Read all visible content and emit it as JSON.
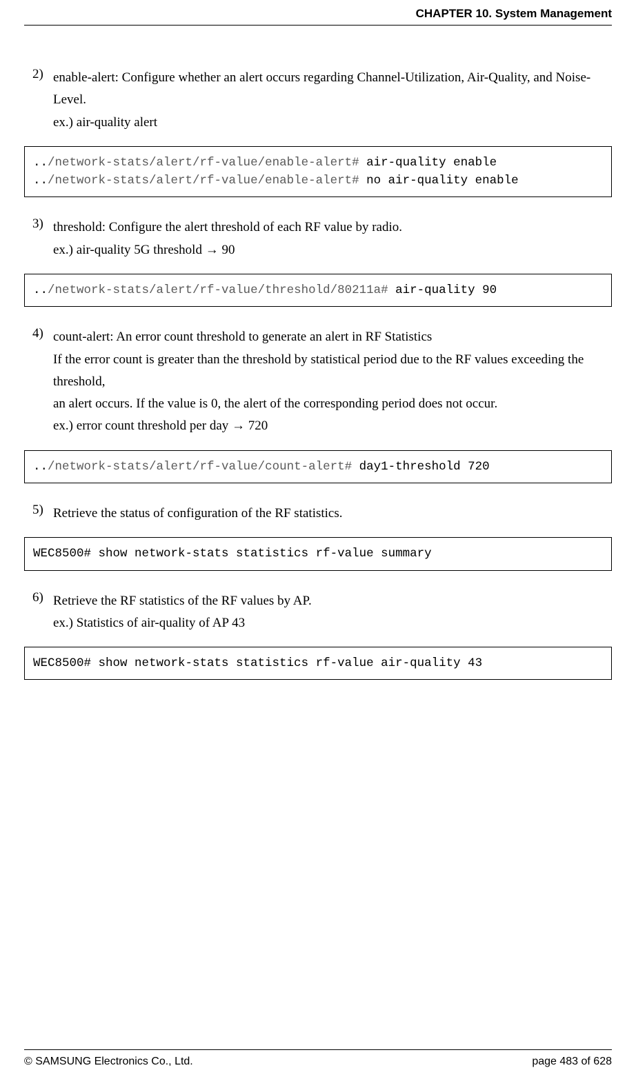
{
  "header": {
    "chapter": "CHAPTER 10. System Management"
  },
  "items": [
    {
      "num": "2)",
      "text": "enable-alert: Configure whether an alert occurs regarding Channel-Utilization, Air-Quality, and Noise-Level.",
      "example": "ex.) air-quality alert",
      "code_prefix": "..",
      "code_path1": "/network-stats/alert/rf-value/enable-alert#",
      "code_suffix1": " air-quality enable",
      "code_path2": "/network-stats/alert/rf-value/enable-alert#",
      "code_suffix2": " no air-quality enable"
    },
    {
      "num": "3)",
      "text": "threshold: Configure the alert threshold of each RF value by radio.",
      "example": "ex.) air-quality 5G threshold → 90",
      "code_prefix": "..",
      "code_path1": "/network-stats/alert/rf-value/threshold/80211a#",
      "code_suffix1": " air-quality 90"
    },
    {
      "num": "4)",
      "text": "count-alert: An error count threshold to generate an alert in RF Statistics",
      "text2": "If the error count is greater than the threshold by statistical period due to the RF values exceeding the threshold,",
      "text3": "an alert occurs. If the value is 0, the alert of the corresponding period does not occur.",
      "example": "ex.) error count threshold per day → 720",
      "code_prefix": "..",
      "code_path1": "/network-stats/alert/rf-value/count-alert#",
      "code_suffix1": " day1-threshold 720"
    },
    {
      "num": "5)",
      "text": "Retrieve the status of configuration of the RF statistics.",
      "code_full": "WEC8500# show network-stats statistics rf-value summary"
    },
    {
      "num": "6)",
      "text": "Retrieve the RF statistics of the RF values by AP.",
      "example": "ex.) Statistics of air-quality of AP 43",
      "code_full": "WEC8500# show network-stats statistics rf-value air-quality 43"
    }
  ],
  "footer": {
    "copyright": "© SAMSUNG Electronics Co., Ltd.",
    "page": "page 483 of 628"
  }
}
